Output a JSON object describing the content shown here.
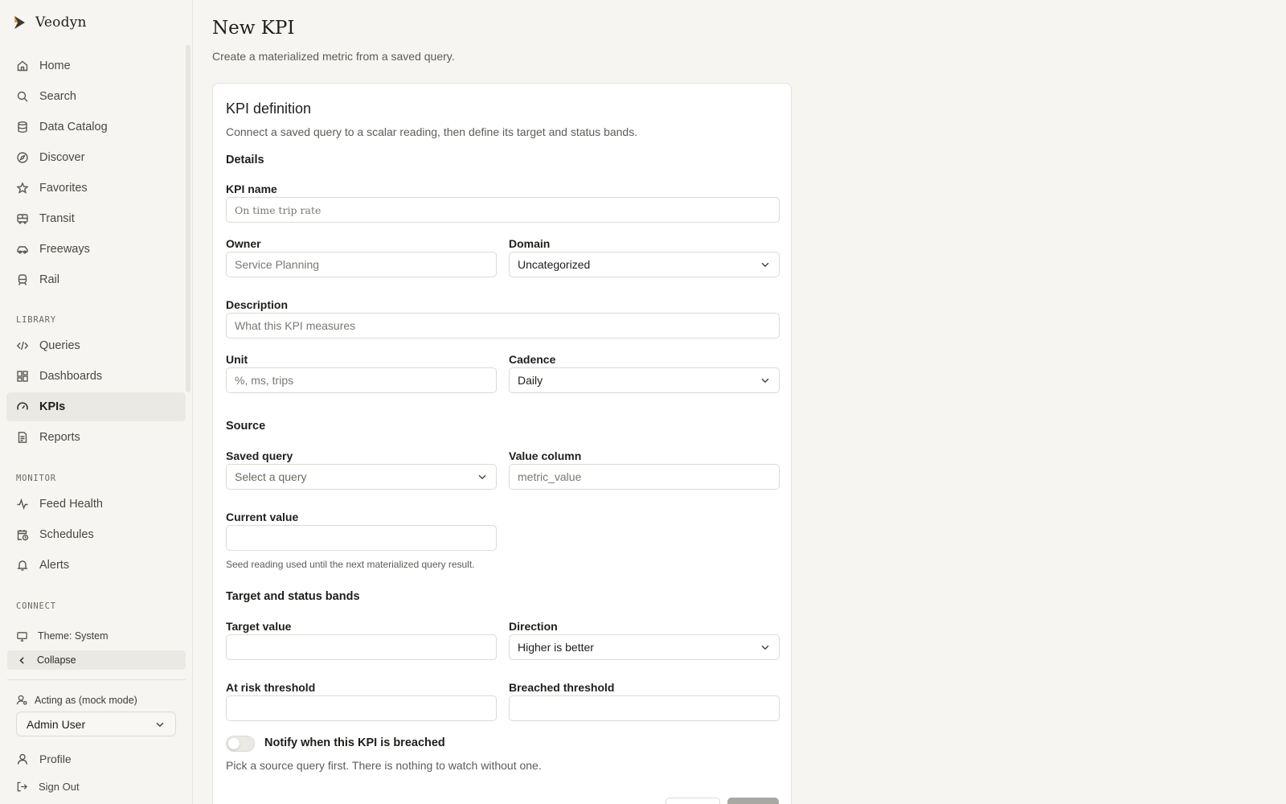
{
  "app": {
    "name": "Veodyn"
  },
  "sidebar": {
    "main_items": [
      {
        "label": "Home",
        "icon": "home-icon"
      },
      {
        "label": "Search",
        "icon": "search-icon"
      },
      {
        "label": "Data Catalog",
        "icon": "database-icon"
      },
      {
        "label": "Discover",
        "icon": "compass-icon"
      },
      {
        "label": "Favorites",
        "icon": "star-icon"
      },
      {
        "label": "Transit",
        "icon": "bus-icon"
      },
      {
        "label": "Freeways",
        "icon": "car-icon"
      },
      {
        "label": "Rail",
        "icon": "train-icon"
      }
    ],
    "library_heading": "LIBRARY",
    "library_items": [
      {
        "label": "Queries",
        "icon": "code-icon"
      },
      {
        "label": "Dashboards",
        "icon": "grid-icon"
      },
      {
        "label": "KPIs",
        "icon": "gauge-icon",
        "active": true
      },
      {
        "label": "Reports",
        "icon": "document-icon"
      }
    ],
    "monitor_heading": "MONITOR",
    "monitor_items": [
      {
        "label": "Feed Health",
        "icon": "activity-icon"
      },
      {
        "label": "Schedules",
        "icon": "calendar-clock-icon"
      },
      {
        "label": "Alerts",
        "icon": "bell-icon"
      }
    ],
    "connect_heading": "CONNECT",
    "theme_label": "Theme: System",
    "collapse_label": "Collapse",
    "acting_label": "Acting as (mock mode)",
    "acting_user": "Admin User",
    "profile_label": "Profile",
    "signout_label": "Sign Out"
  },
  "page": {
    "title": "New KPI",
    "subtitle": "Create a materialized metric from a saved query."
  },
  "form": {
    "title": "KPI definition",
    "description": "Connect a saved query to a scalar reading, then define its target and status bands.",
    "details_heading": "Details",
    "kpi_name": {
      "label": "KPI name",
      "placeholder": "On time trip rate",
      "value": ""
    },
    "owner": {
      "label": "Owner",
      "placeholder": "Service Planning",
      "value": ""
    },
    "domain": {
      "label": "Domain",
      "value": "Uncategorized"
    },
    "description_field": {
      "label": "Description",
      "placeholder": "What this KPI measures",
      "value": ""
    },
    "unit": {
      "label": "Unit",
      "placeholder": "%, ms, trips",
      "value": ""
    },
    "cadence": {
      "label": "Cadence",
      "value": "Daily"
    },
    "source_heading": "Source",
    "saved_query": {
      "label": "Saved query",
      "value": "Select a query"
    },
    "value_column": {
      "label": "Value column",
      "placeholder": "metric_value",
      "value": ""
    },
    "current_value": {
      "label": "Current value",
      "value": "",
      "hint": "Seed reading used until the next materialized query result."
    },
    "target_heading": "Target and status bands",
    "target_value": {
      "label": "Target value",
      "value": ""
    },
    "direction": {
      "label": "Direction",
      "value": "Higher is better"
    },
    "at_risk": {
      "label": "At risk threshold",
      "value": ""
    },
    "breached": {
      "label": "Breached threshold",
      "value": ""
    },
    "notify": {
      "label": "Notify when this KPI is breached",
      "enabled": false
    },
    "notify_hint": "Pick a source query first. There is nothing to watch without one."
  },
  "colors": {
    "background": "#f6f5f1",
    "active_nav": "#ebe9e4",
    "primary_disabled": "#a9a8a3"
  }
}
